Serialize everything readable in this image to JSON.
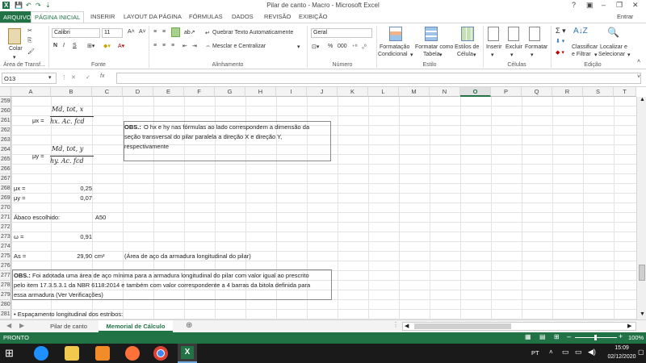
{
  "window": {
    "title": "Pilar de canto - Macro - Microsoft Excel",
    "help": "?",
    "signin": "Entrar"
  },
  "tabs": {
    "file": "ARQUIVO",
    "items": [
      "PÁGINA INICIAL",
      "INSERIR",
      "LAYOUT DA PÁGINA",
      "FÓRMULAS",
      "DADOS",
      "REVISÃO",
      "EXIBIÇÃO"
    ]
  },
  "ribbon": {
    "paste": "Colar",
    "font_name": "Calibri",
    "font_size": "11",
    "wrap_text": "Quebrar Texto Automaticamente",
    "merge_center": "Mesclar e Centralizar",
    "number_format": "Geral",
    "cond_format": "Formatação",
    "cond_format2": "Condicional",
    "format_table": "Formatar como",
    "format_table2": "Tabela",
    "cell_styles": "Estilos de",
    "cell_styles2": "Célula",
    "insert": "Inserir",
    "delete": "Excluir",
    "format": "Formatar",
    "sort_filter": "Classificar",
    "sort_filter2": "e Filtrar",
    "find_select": "Localizar e",
    "find_select2": "Selecionar",
    "groups": [
      "Área de Transf...",
      "Fonte",
      "Alinhamento",
      "Número",
      "Estilo",
      "Células",
      "Edição"
    ],
    "bold": "N",
    "italic": "I",
    "underline": "S"
  },
  "formula_bar": {
    "name_box": "O13",
    "fx": "fx",
    "content": ""
  },
  "columns": [
    "A",
    "B",
    "C",
    "D",
    "E",
    "F",
    "G",
    "H",
    "I",
    "J",
    "K",
    "L",
    "M",
    "N",
    "O",
    "P",
    "Q",
    "R",
    "S",
    "T"
  ],
  "selected_column": "O",
  "rows": [
    "259",
    "260",
    "261",
    "262",
    "263",
    "264",
    "265",
    "266",
    "267",
    "268",
    "269",
    "270",
    "271",
    "272",
    "273",
    "274",
    "275",
    "276",
    "277",
    "278",
    "279",
    "280",
    "281"
  ],
  "cells": {
    "r260_A": "μx =",
    "f1_num": "Md, tot, x",
    "f1_den": "hx. Ac. fcd",
    "obs1_a": "OBS.:",
    "obs1_b": "O hx e hy nas fórmulas ao lado correspondem a dimensão da",
    "obs1_c": "seção transversal do pilar paralela a direção X e direção Y,",
    "obs1_d": "respectivamente",
    "r264_A": "μy =",
    "f2_num": "Md, tot, y",
    "f2_den": "hy. Ac. fcd",
    "r268_A": "μx =",
    "r268_B": "0,25",
    "r269_A": "μy =",
    "r269_B": "0,07",
    "r271_A": "Ábaco escolhido:",
    "r271_C": "A50",
    "r273_A": "ω =",
    "r273_B": "0,91",
    "r275_A": "As =",
    "r275_B": "29,90",
    "r275_C": "cm²",
    "r275_D": "(Área de aço da armadura longitudinal do pilar)",
    "obs2_a": "OBS.:",
    "obs2_b": "Foi adotada uma área de aço mínima para a armadura longitudinal do pilar com valor igual ao prescrito",
    "obs2_c": "pelo item 17.3.5.3.1 da NBR 6118:2014 e também com valor correspondente a 4 barras da bitola definida para",
    "obs2_d": "essa armadura (Ver Verificações)",
    "r281_A": "• Espaçamento longitudinal dos estribos:"
  },
  "sheets": [
    "Pilar de canto",
    "Memorial de Cálculo"
  ],
  "active_sheet": "Memorial de Cálculo",
  "status": {
    "ready": "PRONTO",
    "zoom": "100%"
  },
  "taskbar": {
    "lang": "PT",
    "time": "15:09",
    "date": "02/12/2020"
  },
  "colors": {
    "excel_green": "#217346",
    "taskbar": "#1a1a1a"
  }
}
